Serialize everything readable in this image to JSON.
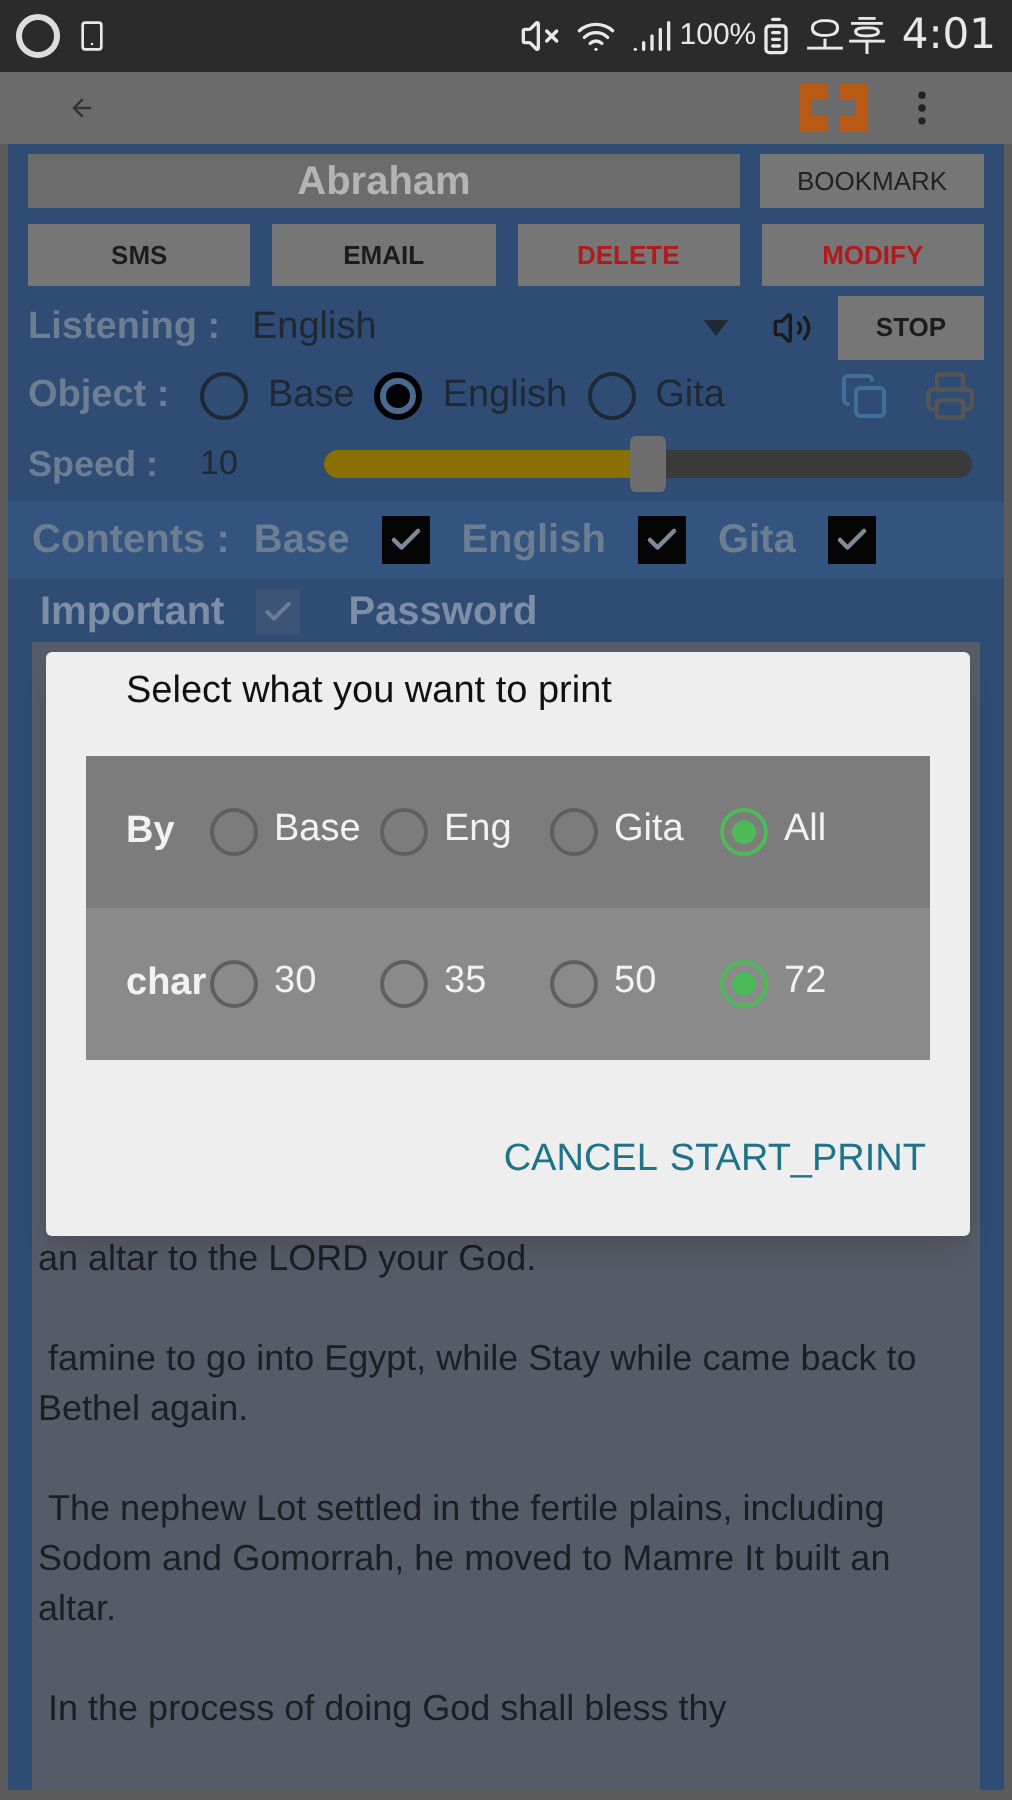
{
  "status_bar": {
    "battery": "100%",
    "time": "오후 4:01"
  },
  "title": "Abraham",
  "bookmark": "BOOKMARK",
  "actions": [
    {
      "label": "SMS",
      "kind": "normal"
    },
    {
      "label": "EMAIL",
      "kind": "normal"
    },
    {
      "label": "DELETE",
      "kind": "danger"
    },
    {
      "label": "MODIFY",
      "kind": "danger"
    }
  ],
  "listening": {
    "label": "Listening :",
    "value": "English",
    "button": "STOP"
  },
  "object": {
    "label": "Object :",
    "options": [
      {
        "label": "Base",
        "selected": false
      },
      {
        "label": "English",
        "selected": true
      },
      {
        "label": "Gita",
        "selected": false
      }
    ]
  },
  "speed": {
    "label": "Speed :",
    "value": "10",
    "level": 0.5
  },
  "contents": {
    "label": "Contents :",
    "items": [
      {
        "label": "Base",
        "checked": true
      },
      {
        "label": "English",
        "checked": true
      },
      {
        "label": "Gita",
        "checked": true
      }
    ]
  },
  "important": {
    "label": "Important",
    "checked": true,
    "password": "Password"
  },
  "body": [
    "an altar to the LORD your God.",
    " famine to go into Egypt, while Stay while came back to Bethel again.",
    " The nephew Lot settled in the fertile plains, including Sodom and Gomorrah, he moved to Mamre It built an altar.",
    " In the process of doing God shall bless thy"
  ],
  "dialog": {
    "title": "Select what you want to print",
    "groups": [
      {
        "label": "By",
        "options": [
          {
            "label": "Base",
            "selected": false
          },
          {
            "label": "Eng",
            "selected": false
          },
          {
            "label": "Gita",
            "selected": false
          },
          {
            "label": "All",
            "selected": true
          }
        ]
      },
      {
        "label": "char",
        "options": [
          {
            "label": "30",
            "selected": false
          },
          {
            "label": "35",
            "selected": false
          },
          {
            "label": "50",
            "selected": false
          },
          {
            "label": "72",
            "selected": true
          }
        ]
      }
    ],
    "buttons": [
      "CANCEL",
      "START_PRINT"
    ]
  }
}
